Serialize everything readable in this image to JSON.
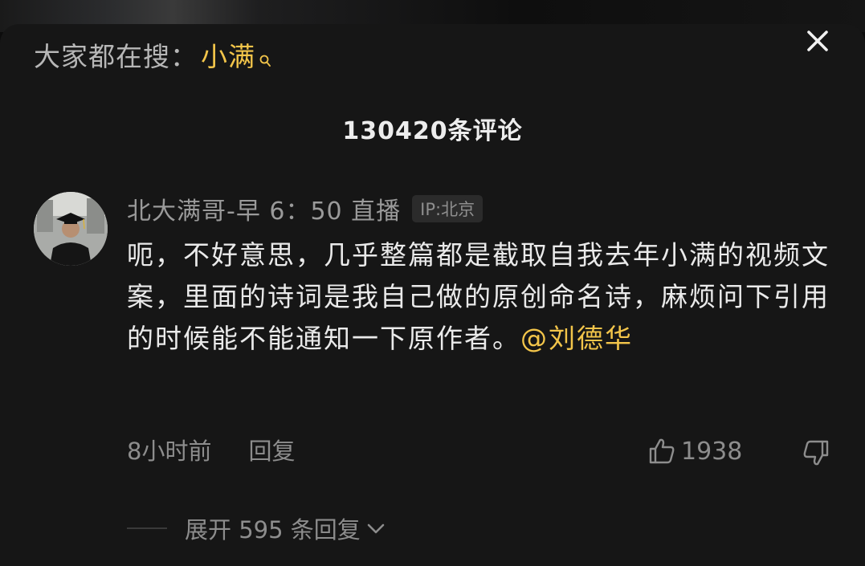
{
  "trending": {
    "prefix": "大家都在搜：",
    "term": "小满",
    "search_icon": "search-icon"
  },
  "header": {
    "comment_count": "130420条评论",
    "close_icon": "close-icon"
  },
  "comment": {
    "username": "北大满哥-早 6：50 直播",
    "ip_location": "IP:北京",
    "text": "呃，不好意思，几乎整篇都是截取自我去年小满的视频文案，里面的诗词是我自己做的原创命名诗，麻烦问下引用的时候能不能通知一下原作者。",
    "mention": "@刘德华",
    "time": "8小时前",
    "reply_label": "回复",
    "like_count": "1938",
    "like_icon": "thumbs-up-icon",
    "dislike_icon": "thumbs-down-icon"
  },
  "replies": {
    "expand_label": "展开 595 条回复",
    "chevron_icon": "chevron-down-icon"
  },
  "colors": {
    "accent": "#f3c54a",
    "background": "#161616",
    "text_primary": "#eaeaea",
    "text_secondary": "#8d8d8d"
  }
}
